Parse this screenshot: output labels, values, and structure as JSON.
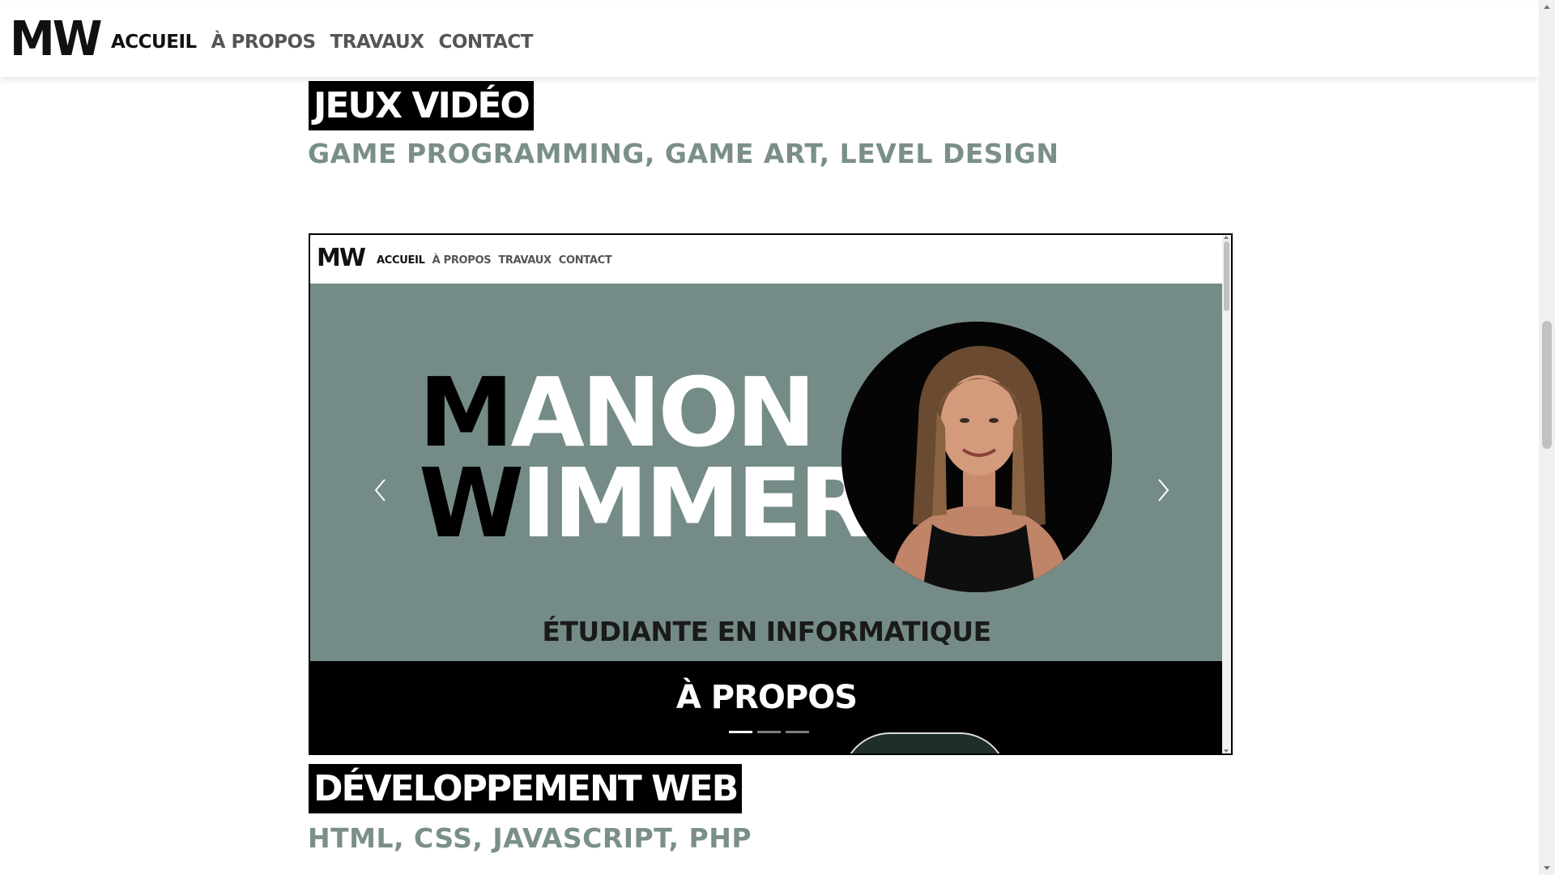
{
  "header": {
    "logo": "MW",
    "nav": [
      {
        "label": "ACCUEIL",
        "active": true
      },
      {
        "label": "À PROPOS",
        "active": false
      },
      {
        "label": "TRAVAUX",
        "active": false
      },
      {
        "label": "CONTACT",
        "active": false
      }
    ]
  },
  "sections": [
    {
      "title": "JEUX VIDÉO",
      "subtitle": "GAME PROGRAMMING, GAME ART, LEVEL DESIGN"
    },
    {
      "title": "DÉVELOPPEMENT WEB",
      "subtitle": "HTML, CSS, JAVASCRIPT, PHP"
    }
  ],
  "preview": {
    "logo": "MW",
    "nav": [
      {
        "label": "ACCUEIL",
        "active": true
      },
      {
        "label": "À PROPOS",
        "active": false
      },
      {
        "label": "TRAVAUX",
        "active": false
      },
      {
        "label": "CONTACT",
        "active": false
      }
    ],
    "hero": {
      "first_line_initial": "M",
      "first_line_rest": "ANON",
      "second_line_initial": "W",
      "second_line_rest": "IMMER",
      "subtitle": "ÉTUDIANTE EN INFORMATIQUE"
    },
    "about_title": "À PROPOS",
    "carousel": {
      "slides": 3,
      "active_index": 0
    }
  },
  "colors": {
    "hero_bg": "#758b87",
    "subtitle_accent": "#7a8f8a",
    "title_bg": "#000000"
  },
  "icons": [
    "chevron-left-icon",
    "chevron-right-icon"
  ]
}
